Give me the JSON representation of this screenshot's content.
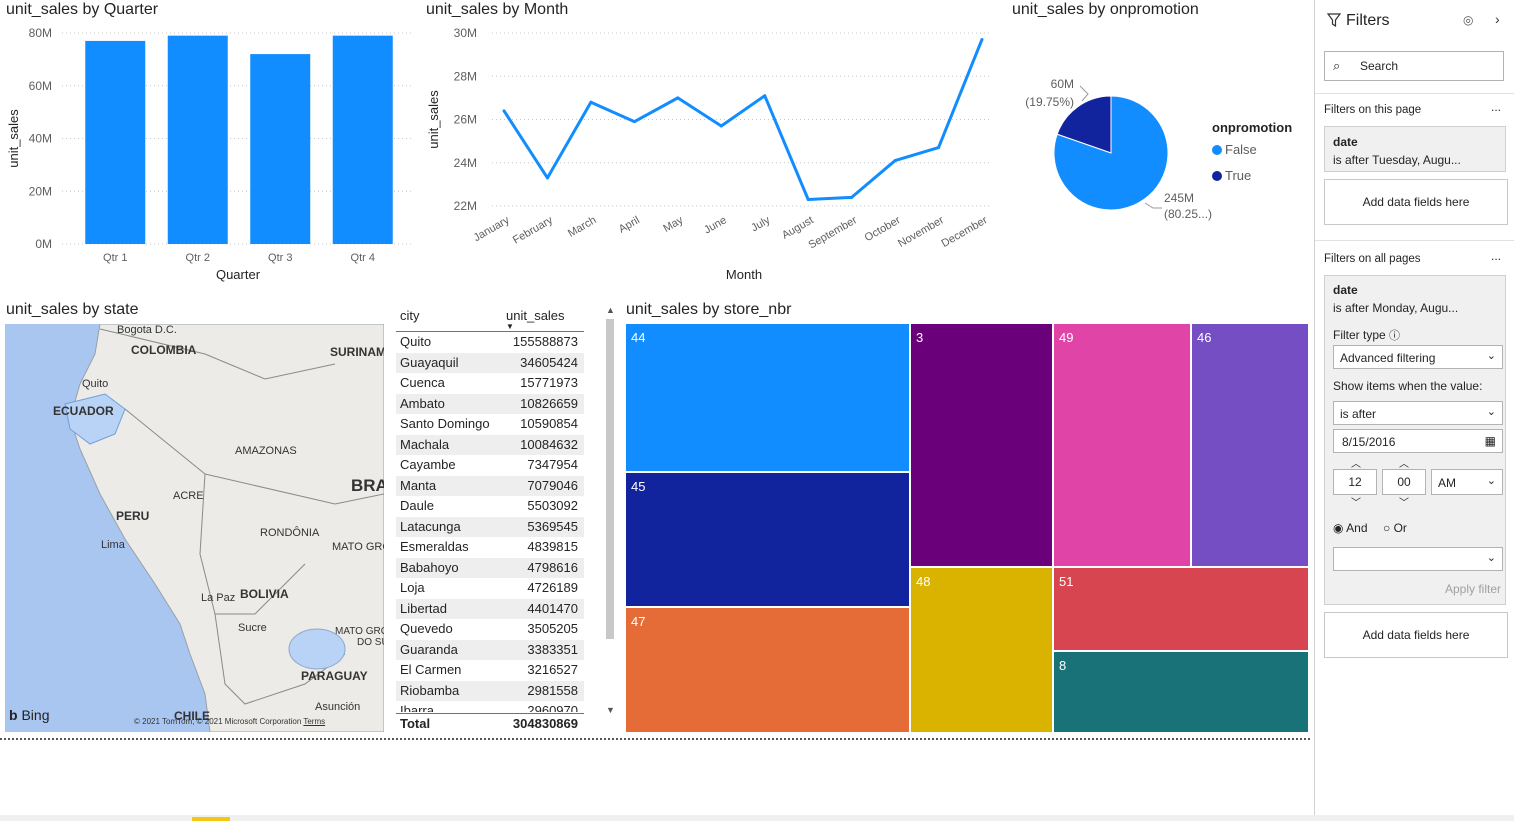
{
  "visuals": {
    "quarter": {
      "title": "unit_sales by Quarter",
      "chart_data": {
        "type": "bar",
        "categories": [
          "Qtr 1",
          "Qtr 2",
          "Qtr 3",
          "Qtr 4"
        ],
        "values": [
          77,
          79,
          72,
          79
        ],
        "ylim": [
          0,
          80
        ],
        "yticks": [
          "0M",
          "20M",
          "40M",
          "60M",
          "80M"
        ],
        "xlabel": "Quarter",
        "ylabel": "unit_sales",
        "color": "#118DFF"
      }
    },
    "month": {
      "title": "unit_sales by Month",
      "chart_data": {
        "type": "line",
        "categories": [
          "January",
          "February",
          "March",
          "April",
          "May",
          "June",
          "July",
          "August",
          "September",
          "October",
          "November",
          "December"
        ],
        "values": [
          26.4,
          23.3,
          26.8,
          25.9,
          27.0,
          25.7,
          27.1,
          22.3,
          22.4,
          24.1,
          24.7,
          29.7
        ],
        "ylim": [
          22,
          30
        ],
        "yticks": [
          "22M",
          "24M",
          "26M",
          "28M",
          "30M"
        ],
        "xlabel": "Month",
        "ylabel": "unit_sales",
        "color": "#118DFF"
      }
    },
    "promo": {
      "title": "unit_sales by onpromotion",
      "legend_title": "onpromotion",
      "chart_data": {
        "type": "pie",
        "slices": [
          {
            "name": "False",
            "value": 245,
            "label_value": "245M",
            "label_pct": "(80.25...)",
            "color": "#118DFF"
          },
          {
            "name": "True",
            "value": 60,
            "label_value": "60M",
            "label_pct": "(19.75%)",
            "color": "#12239E"
          }
        ]
      }
    },
    "state": {
      "title": "unit_sales by state",
      "labels": {
        "bogota": "Bogota D.C.",
        "colombia": "COLOMBIA",
        "suriname": "SURINAME",
        "quito": "Quito",
        "ecuador": "ECUADOR",
        "amazonas": "AMAZONAS",
        "acre": "ACRE",
        "bra": "BRA",
        "peru": "PERU",
        "rondonia": "RONDÔNIA",
        "mato1": "MATO GROS",
        "lima": "Lima",
        "lapaz": "La Paz",
        "bolivia": "BOLIVIA",
        "sucre": "Sucre",
        "mato2": "MATO GRO",
        "dosu": "DO SU",
        "paraguay": "PARAGUAY",
        "asuncion": "Asunción",
        "chile": "CHILE",
        "bing": "Bing",
        "copyright": "© 2021 TomTom, © 2021 Microsoft Corporation",
        "terms": "Terms"
      }
    },
    "table": {
      "col_city": "city",
      "col_sales": "unit_sales",
      "rows": [
        {
          "city": "Quito",
          "sales": "155588873"
        },
        {
          "city": "Guayaquil",
          "sales": "34605424"
        },
        {
          "city": "Cuenca",
          "sales": "15771973"
        },
        {
          "city": "Ambato",
          "sales": "10826659"
        },
        {
          "city": "Santo Domingo",
          "sales": "10590854"
        },
        {
          "city": "Machala",
          "sales": "10084632"
        },
        {
          "city": "Cayambe",
          "sales": "7347954"
        },
        {
          "city": "Manta",
          "sales": "7079046"
        },
        {
          "city": "Daule",
          "sales": "5503092"
        },
        {
          "city": "Latacunga",
          "sales": "5369545"
        },
        {
          "city": "Esmeraldas",
          "sales": "4839815"
        },
        {
          "city": "Babahoyo",
          "sales": "4798616"
        },
        {
          "city": "Loja",
          "sales": "4726189"
        },
        {
          "city": "Libertad",
          "sales": "4401470"
        },
        {
          "city": "Quevedo",
          "sales": "3505205"
        },
        {
          "city": "Guaranda",
          "sales": "3383351"
        },
        {
          "city": "El Carmen",
          "sales": "3216527"
        },
        {
          "city": "Riobamba",
          "sales": "2981558"
        },
        {
          "city": "Ibarra",
          "sales": "2960970"
        }
      ],
      "total_label": "Total",
      "total_value": "304830869"
    },
    "store": {
      "title": "unit_sales by store_nbr",
      "cells": [
        {
          "label": "44",
          "color": "#118DFF"
        },
        {
          "label": "45",
          "color": "#12239E"
        },
        {
          "label": "47",
          "color": "#E66C37"
        },
        {
          "label": "3",
          "color": "#6B007B"
        },
        {
          "label": "48",
          "color": "#D9B300"
        },
        {
          "label": "49",
          "color": "#E044A7"
        },
        {
          "label": "46",
          "color": "#744EC2"
        },
        {
          "label": "51",
          "color": "#D64550"
        },
        {
          "label": "8",
          "color": "#197278"
        }
      ]
    }
  },
  "filters": {
    "title": "Filters",
    "search_placeholder": "Search",
    "page_section": "Filters on this page",
    "page_card": {
      "field": "date",
      "summary": "is after Tuesday, Augu..."
    },
    "add_fields": "Add data fields here",
    "all_section": "Filters on all pages",
    "all_card": {
      "field": "date",
      "summary": "is after Monday, Augu...",
      "filter_type_label": "Filter type",
      "filter_type_value": "Advanced filtering",
      "show_items_label": "Show items when the value:",
      "condition": "is after",
      "date_value": "8/15/2016",
      "hour": "12",
      "minute": "00",
      "ampm": "AM",
      "and_label": "And",
      "or_label": "Or",
      "apply_label": "Apply filter"
    },
    "more": "..."
  }
}
